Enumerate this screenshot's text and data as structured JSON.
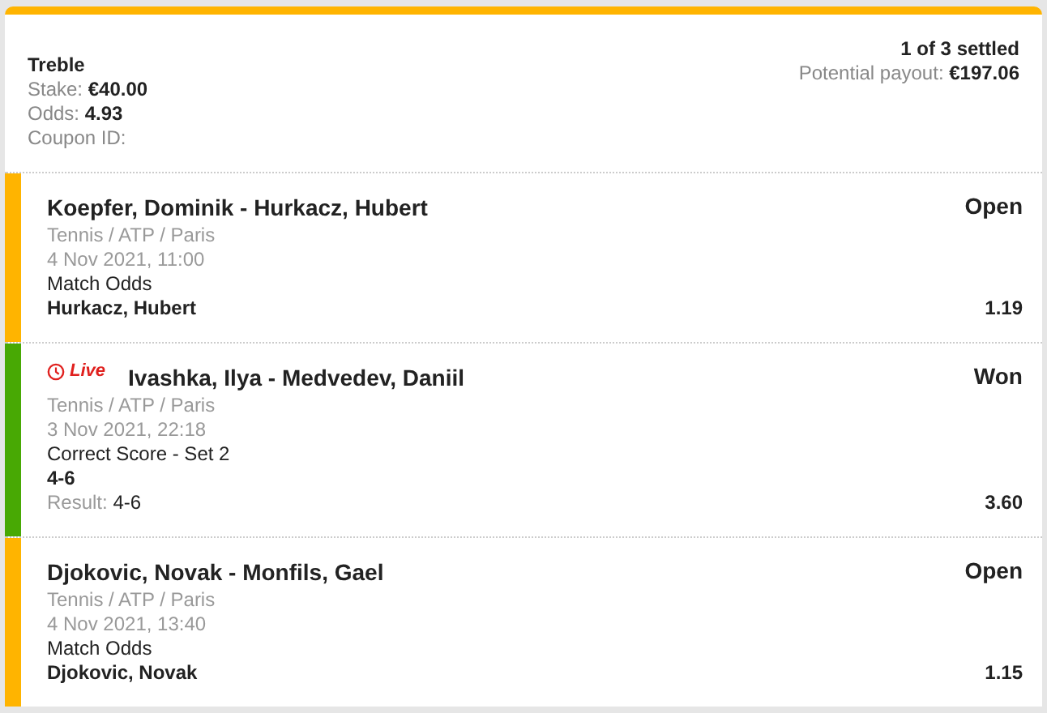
{
  "coupon": {
    "type": "Treble",
    "stake_label": "Stake:",
    "stake": "€40.00",
    "odds_label": "Odds:",
    "odds": "4.93",
    "coupon_id_label": "Coupon ID:",
    "settled": "1 of 3 settled",
    "payout_label": "Potential payout:",
    "payout": "€197.06"
  },
  "selections": [
    {
      "event": "Koepfer, Dominik - Hurkacz, Hubert",
      "live": false,
      "status": "Open",
      "color": "#ffb400",
      "category": "Tennis / ATP / Paris",
      "date": "4 Nov 2021, 11:00",
      "market": "Match Odds",
      "pick": "Hurkacz, Hubert",
      "odds": "1.19"
    },
    {
      "event": "Ivashka, Ilya - Medvedev, Daniil",
      "live": true,
      "live_label": "Live",
      "status": "Won",
      "color": "#48a904",
      "category": "Tennis / ATP / Paris",
      "date": "3 Nov 2021, 22:18",
      "market": "Correct Score - Set 2",
      "pick": "4-6",
      "odds": "3.60",
      "result_label": "Result:",
      "result": "4-6"
    },
    {
      "event": "Djokovic, Novak - Monfils, Gael",
      "live": false,
      "status": "Open",
      "color": "#ffb400",
      "category": "Tennis / ATP / Paris",
      "date": "4 Nov 2021, 13:40",
      "market": "Match Odds",
      "pick": "Djokovic, Novak",
      "odds": "1.15"
    }
  ]
}
